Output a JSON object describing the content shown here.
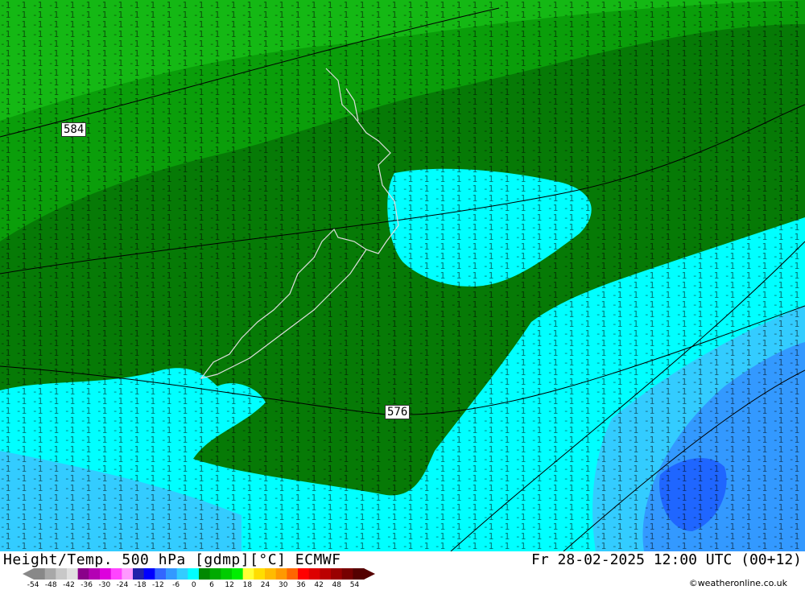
{
  "map": {
    "height_contour_labels": [
      "584",
      "576"
    ],
    "colors": {
      "t_minus_8": "#14b814",
      "t_minus_11": "#0a9e0a",
      "t_minus_13": "#067a06",
      "t_minus_15": "#00ffff",
      "t_minus_17": "#33ccff",
      "t_minus_20": "#3399ff",
      "t_minus_22": "#1f66ff",
      "coast": "#dddddd",
      "contours": "#000000"
    }
  },
  "footer": {
    "title": "Height/Temp. 500 hPa [gdmp][°C] ECMWF",
    "runtime": "Fr 28-02-2025 12:00 UTC (00+12)",
    "credit": "©weatheronline.co.uk",
    "scale_ticks": [
      "-54",
      "-48",
      "-42",
      "-36",
      "-30",
      "-24",
      "-18",
      "-12",
      "-6",
      "0",
      "6",
      "12",
      "18",
      "24",
      "30",
      "36",
      "42",
      "48",
      "54"
    ],
    "scale_colors": [
      "#888888",
      "#a8a8a8",
      "#c8c8c8",
      "#e0e0e0",
      "#8a008a",
      "#b400b4",
      "#dd00dd",
      "#ff44ff",
      "#ff99ff",
      "#2222aa",
      "#0000ff",
      "#3366ff",
      "#3399ff",
      "#33ccff",
      "#00ffff",
      "#008800",
      "#00aa00",
      "#00cc00",
      "#00ee00",
      "#ffff33",
      "#ffdd00",
      "#ffbb00",
      "#ff9900",
      "#ff6600",
      "#ff0000",
      "#dd0000",
      "#bb0000",
      "#990000",
      "#770000",
      "#550000"
    ]
  }
}
